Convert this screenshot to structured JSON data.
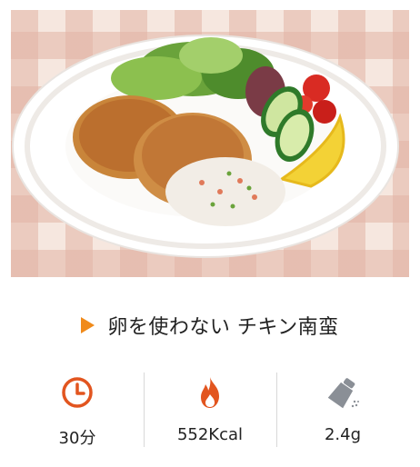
{
  "recipe": {
    "title": "卵を使わない チキン南蛮"
  },
  "stats": [
    {
      "icon": "clock-icon",
      "value": "30分"
    },
    {
      "icon": "flame-icon",
      "value": "552Kcal"
    },
    {
      "icon": "salt-shaker-icon",
      "value": "2.4g"
    }
  ],
  "colors": {
    "accent": "#f08a1a",
    "clock": "#e2551f",
    "flame": "#e2551f",
    "salt": "#8a8f96"
  }
}
